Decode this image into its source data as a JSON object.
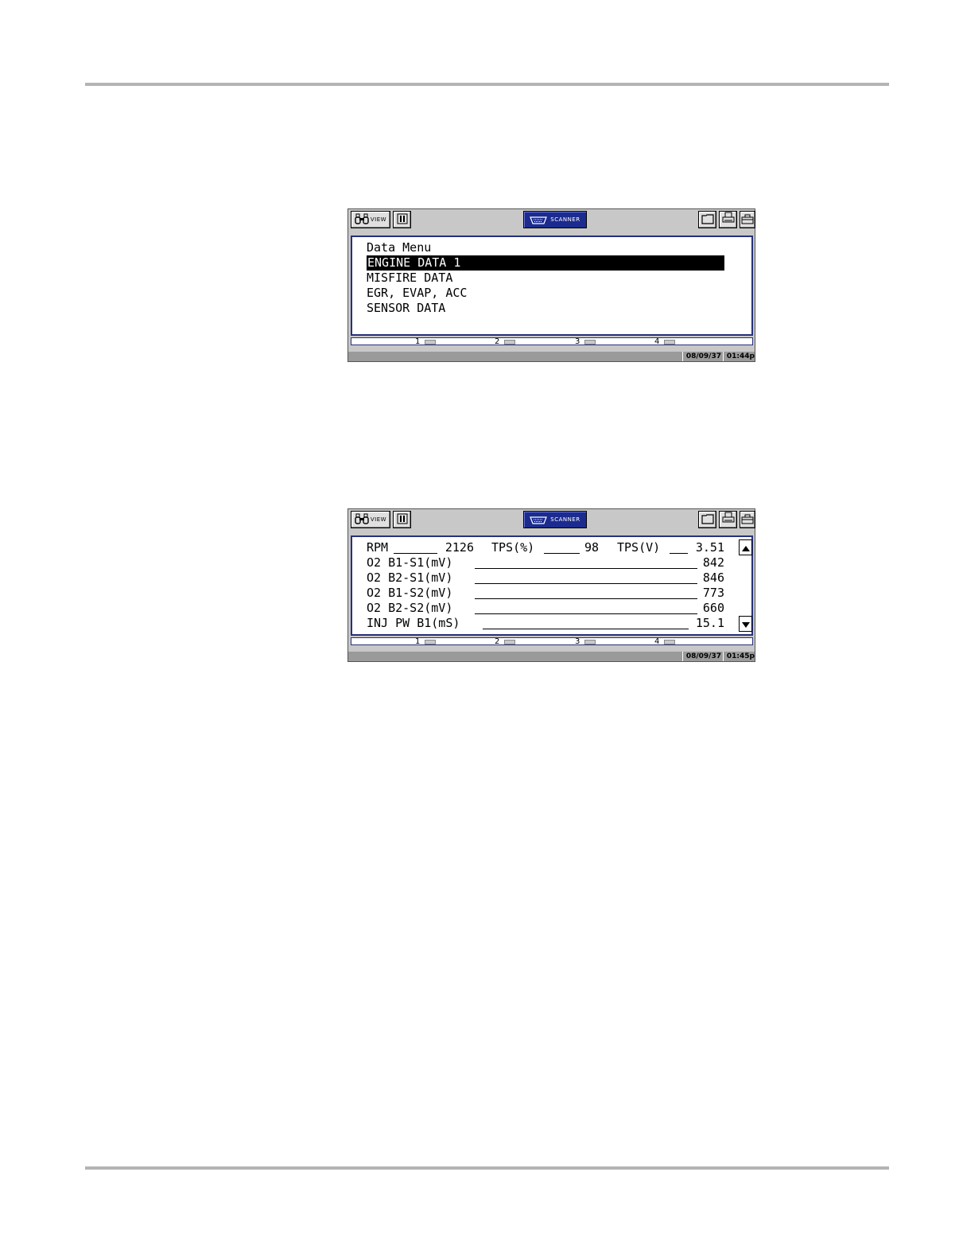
{
  "screen1": {
    "toolbar": {
      "view_label": "VIEW",
      "scanner_label": "SCANNER"
    },
    "menu": {
      "title": "Data Menu",
      "items": [
        {
          "label": "ENGINE DATA 1",
          "selected": true
        },
        {
          "label": "MISFIRE DATA",
          "selected": false
        },
        {
          "label": "EGR, EVAP, ACC",
          "selected": false
        },
        {
          "label": "SENSOR DATA",
          "selected": false
        }
      ]
    },
    "softkeys": [
      "1",
      "2",
      "3",
      "4"
    ],
    "status": {
      "date": "08/09/37",
      "time": "01:44p"
    }
  },
  "screen2": {
    "toolbar": {
      "view_label": "VIEW",
      "scanner_label": "SCANNER"
    },
    "row1": [
      {
        "label": "RPM",
        "value": "2126"
      },
      {
        "label": "TPS(%)",
        "value": "98"
      },
      {
        "label": "TPS(V)",
        "value": "3.51"
      }
    ],
    "rows": [
      {
        "label": "O2 B1-S1(mV)",
        "value": "842"
      },
      {
        "label": "O2 B2-S1(mV)",
        "value": "846"
      },
      {
        "label": "O2 B1-S2(mV)",
        "value": "773"
      },
      {
        "label": "O2 B2-S2(mV)",
        "value": "660"
      },
      {
        "label": "INJ PW B1(mS)",
        "value": "15.1"
      }
    ],
    "softkeys": [
      "1",
      "2",
      "3",
      "4"
    ],
    "status": {
      "date": "08/09/37",
      "time": "01:45p"
    }
  }
}
